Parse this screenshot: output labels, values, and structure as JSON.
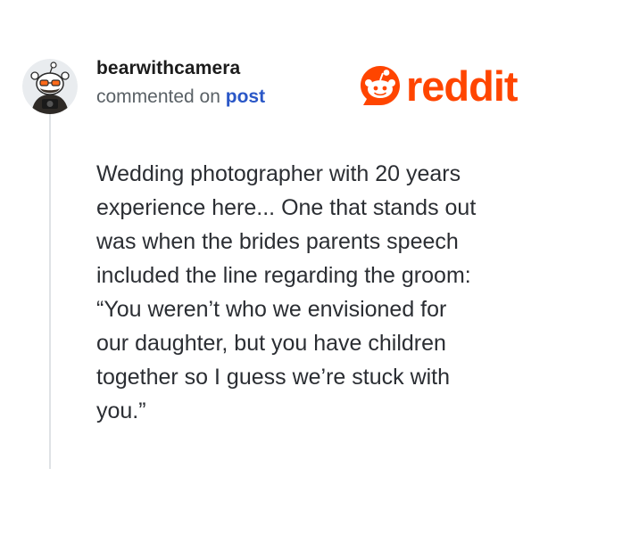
{
  "comment": {
    "author": "bearwithcamera",
    "action_text": "commented on ",
    "target_link": "post",
    "body_lines": [
      "Wedding photographer with 20 years",
      "experience here... One that stands out",
      "was when the brides parents speech",
      "included the line regarding the groom:",
      "“You weren’t who we envisioned for",
      "our daughter, but you have children",
      "together so I guess we’re stuck with",
      "you.”"
    ]
  },
  "brand": {
    "wordmark": "reddit",
    "icon": "reddit-snoo-icon",
    "color": "#ff4500"
  },
  "avatar": {
    "icon": "snoo-avatar-with-camera"
  },
  "colors": {
    "username": "#1c1c1c",
    "meta_text": "#5a6166",
    "link": "#2a57c7",
    "body_text": "#2b2e33",
    "thread_line": "#dfe2e5"
  }
}
